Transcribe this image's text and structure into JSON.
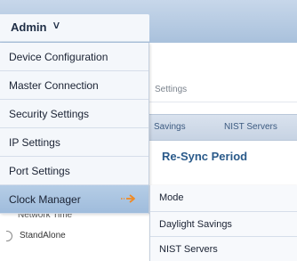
{
  "header": {
    "admin_label": "Admin",
    "admin_chevron": "∨"
  },
  "background": {
    "breadcrumb": "Settings",
    "tabs": [
      "Savings",
      "NIST Servers"
    ],
    "section_title": "Re-Sync Period",
    "network_time": "Network Time",
    "standalone": "StandAlone"
  },
  "menu": {
    "items": [
      {
        "label": "Device Configuration"
      },
      {
        "label": "Master Connection"
      },
      {
        "label": "Security Settings"
      },
      {
        "label": "IP Settings"
      },
      {
        "label": "Port Settings"
      },
      {
        "label": "Clock Manager",
        "active": true
      }
    ]
  },
  "submenu": {
    "items": [
      {
        "label": "Mode"
      },
      {
        "label": "Daylight Savings"
      },
      {
        "label": "NIST Servers"
      }
    ]
  },
  "colors": {
    "header_bar": "#a9c1dc",
    "menu_bg": "#f4f7fb",
    "active_item": "#9fbcdc",
    "arrow": "#f08a24",
    "section_title": "#2a5a8a"
  },
  "icons": {
    "submenu_arrow": "submenu-arrow-icon",
    "admin_chevron": "chevron-down-icon"
  }
}
